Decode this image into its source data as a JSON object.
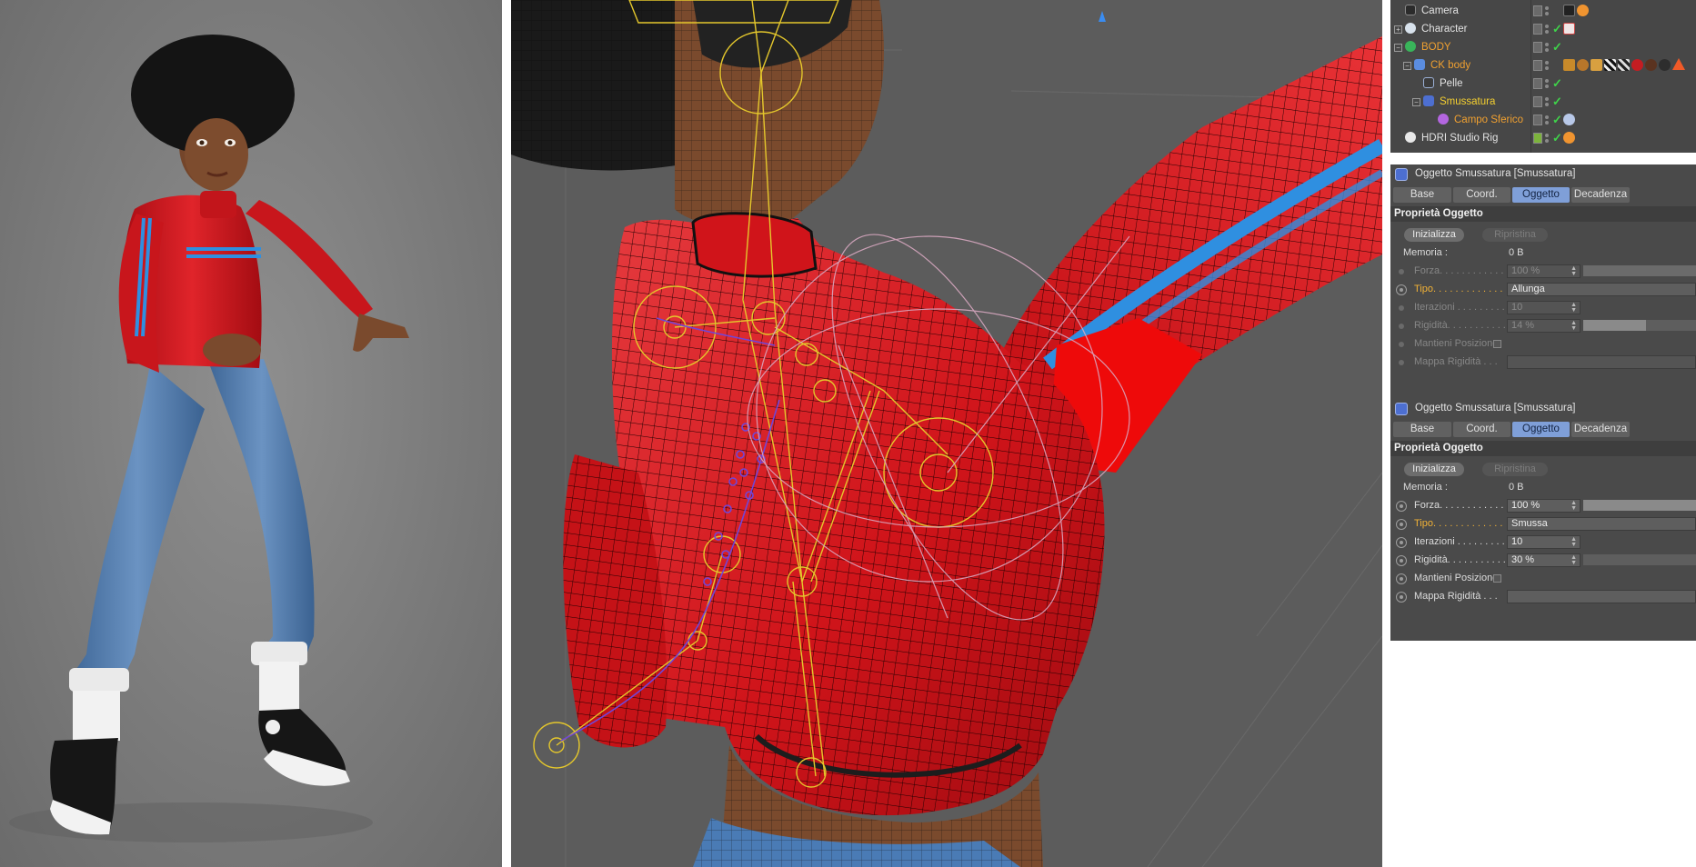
{
  "object_manager": {
    "rows": [
      {
        "name": "Camera",
        "color": "normal",
        "icon": "camera-icon",
        "tags": [
          "off-tag",
          "target-tag"
        ]
      },
      {
        "name": "Character",
        "color": "normal",
        "icon": "character-icon",
        "tags": [
          "character-tag"
        ]
      },
      {
        "name": "BODY",
        "color": "orange",
        "icon": "body-null-icon",
        "tags": []
      },
      {
        "name": "CK body",
        "color": "orange",
        "icon": "joint-icon",
        "tags": [
          "weight-tag",
          "material-tags"
        ]
      },
      {
        "name": "Pelle",
        "color": "normal",
        "icon": "skin-icon",
        "tags": []
      },
      {
        "name": "Smussatura",
        "color": "yellow",
        "icon": "smoothing-deformer-icon",
        "tags": []
      },
      {
        "name": "Campo Sferico",
        "color": "orange",
        "icon": "sphere-field-icon",
        "tags": [
          "field-tag"
        ]
      },
      {
        "name": "HDRI Studio Rig",
        "color": "normal",
        "icon": "hdri-icon",
        "tags": [
          "off-tag"
        ]
      }
    ]
  },
  "attr_panels": [
    {
      "title": "Oggetto Smussatura [Smussatura]",
      "tabs": [
        "Base",
        "Coord.",
        "Oggetto",
        "Decadenza"
      ],
      "active_tab": "Oggetto",
      "section": "Proprietà Oggetto",
      "btn_init": "Inizializza",
      "btn_reset": "Ripristina",
      "memory_label": "Memoria :",
      "memory_value": "0 B",
      "props": {
        "forza_label": "Forza. . . . . . . . . . . . .",
        "forza_value": "100 %",
        "forza_level": 100,
        "tipo_label": "Tipo. . . . . . . . . . . . .",
        "tipo_value": "Allunga",
        "iter_label": "Iterazioni . . . . . . . . .",
        "iter_value": "10",
        "rig_label": "Rigidità. . . . . . . . . . .",
        "rig_value": "14 %",
        "rig_level": 14,
        "mant_label": "Mantieni Posizione",
        "mappa_label": "Mappa Rigidità . . ."
      }
    },
    {
      "title": "Oggetto Smussatura [Smussatura]",
      "tabs": [
        "Base",
        "Coord.",
        "Oggetto",
        "Decadenza"
      ],
      "active_tab": "Oggetto",
      "section": "Proprietà Oggetto",
      "btn_init": "Inizializza",
      "btn_reset": "Ripristina",
      "memory_label": "Memoria :",
      "memory_value": "0 B",
      "props": {
        "forza_label": "Forza. . . . . . . . . . . . .",
        "forza_value": "100 %",
        "forza_level": 100,
        "tipo_label": "Tipo. . . . . . . . . . . . .",
        "tipo_value": "Smussa",
        "iter_label": "Iterazioni . . . . . . . . .",
        "iter_value": "10",
        "rig_label": "Rigidità. . . . . . . . . . .",
        "rig_value": "30 %",
        "rig_level": 30,
        "mant_label": "Mantieni Posizione",
        "mappa_label": "Mappa Rigidità . . ."
      }
    }
  ],
  "colors": {
    "jacket_red": "#d4161b",
    "jacket_stripe": "#2f8fe0",
    "rig_yellow": "#e4c72c",
    "rig_purple": "#7046d8",
    "active_tab": "#7f9fd8",
    "label_highlight": "#f2b236"
  }
}
